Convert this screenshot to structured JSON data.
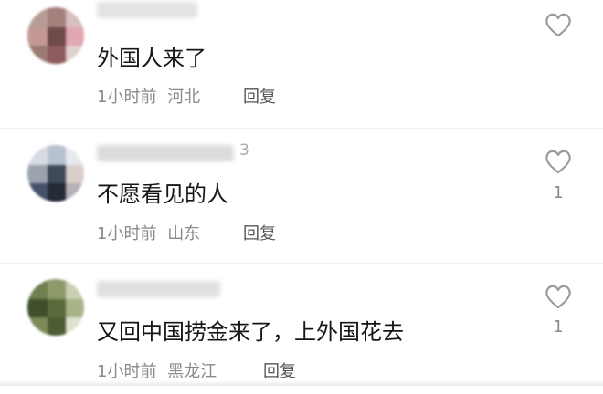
{
  "comments": [
    {
      "username_visible": "",
      "content": "外国人来了",
      "time": "1小时前",
      "region": "河北",
      "reply_label": "回复",
      "like_count": "",
      "avatar_colors": [
        "#b79c96",
        "#a57f7c",
        "#d8c0bd",
        "#8c5c5f",
        "#6f4a4a",
        "#e2a7b0",
        "#c49995",
        "#9c7a74",
        "#e0d2cc"
      ]
    },
    {
      "username_visible": "3",
      "content": "不愿看见的人",
      "time": "1小时前",
      "region": "山东",
      "reply_label": "回复",
      "like_count": "1",
      "avatar_colors": [
        "#d6dbe2",
        "#b8c2cf",
        "#e7e9ee",
        "#9aa3ae",
        "#3f4a58",
        "#d9cfca",
        "#45506b",
        "#242a36",
        "#b7b0b6"
      ]
    },
    {
      "username_visible": "",
      "content": "又回中国捞金来了，上外国花去",
      "time": "1小时前",
      "region": "黑龙江",
      "reply_label": "回复",
      "like_count": "1",
      "avatar_colors": [
        "#6f7f4f",
        "#8d9a6a",
        "#c9cfb4",
        "#3f4f2c",
        "#596b3a",
        "#a8b38a",
        "#7c8a58",
        "#4d5d33",
        "#dfe2d2"
      ]
    }
  ],
  "icons": {
    "like": "heart-outline-icon"
  },
  "colors": {
    "text_primary": "#161616",
    "text_secondary": "#8a8a8a",
    "icon": "#9a9a9a"
  }
}
